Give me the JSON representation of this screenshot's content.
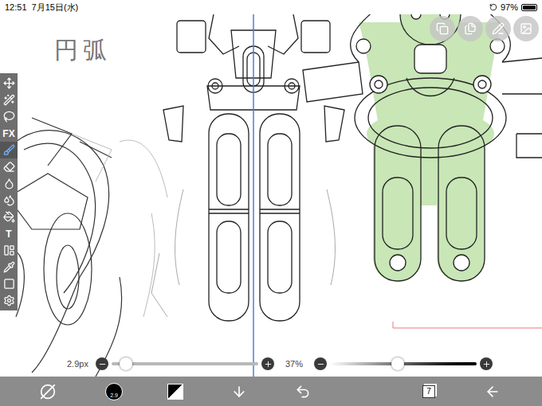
{
  "status_bar": {
    "time": "12:51",
    "date": "7月15日(水)",
    "battery": "97%",
    "battery_level": 0.97
  },
  "canvas": {
    "annotation": "円弧",
    "symmetry_ruler": true
  },
  "toolbar": {
    "tools": [
      {
        "name": "move",
        "kind": "icon",
        "label": "",
        "selected": false
      },
      {
        "name": "wand",
        "kind": "icon",
        "label": "",
        "selected": false
      },
      {
        "name": "lasso",
        "kind": "icon",
        "label": "",
        "selected": false
      },
      {
        "name": "filter",
        "kind": "text",
        "label": "FX",
        "selected": false
      },
      {
        "name": "brush",
        "kind": "icon",
        "label": "",
        "selected": true
      },
      {
        "name": "eraser",
        "kind": "icon",
        "label": "",
        "selected": false
      },
      {
        "name": "smudge",
        "kind": "icon",
        "label": "",
        "selected": false
      },
      {
        "name": "blur",
        "kind": "icon",
        "label": "",
        "selected": false
      },
      {
        "name": "fill",
        "kind": "icon",
        "label": "",
        "selected": false
      },
      {
        "name": "text",
        "kind": "text",
        "label": "T",
        "selected": false
      },
      {
        "name": "frame",
        "kind": "icon",
        "label": "",
        "selected": false
      },
      {
        "name": "eyedropper",
        "kind": "icon",
        "label": "",
        "selected": false
      },
      {
        "name": "shape",
        "kind": "icon",
        "label": "",
        "selected": false
      },
      {
        "name": "settings",
        "kind": "icon",
        "label": "",
        "selected": false
      }
    ]
  },
  "brush_size": {
    "reading": "2.9px",
    "level": 0.1
  },
  "opacity": {
    "reading": "37%",
    "level": 0.46
  },
  "bottom_bar": {
    "brush_preview": "2.9",
    "layer_count": "7"
  }
}
